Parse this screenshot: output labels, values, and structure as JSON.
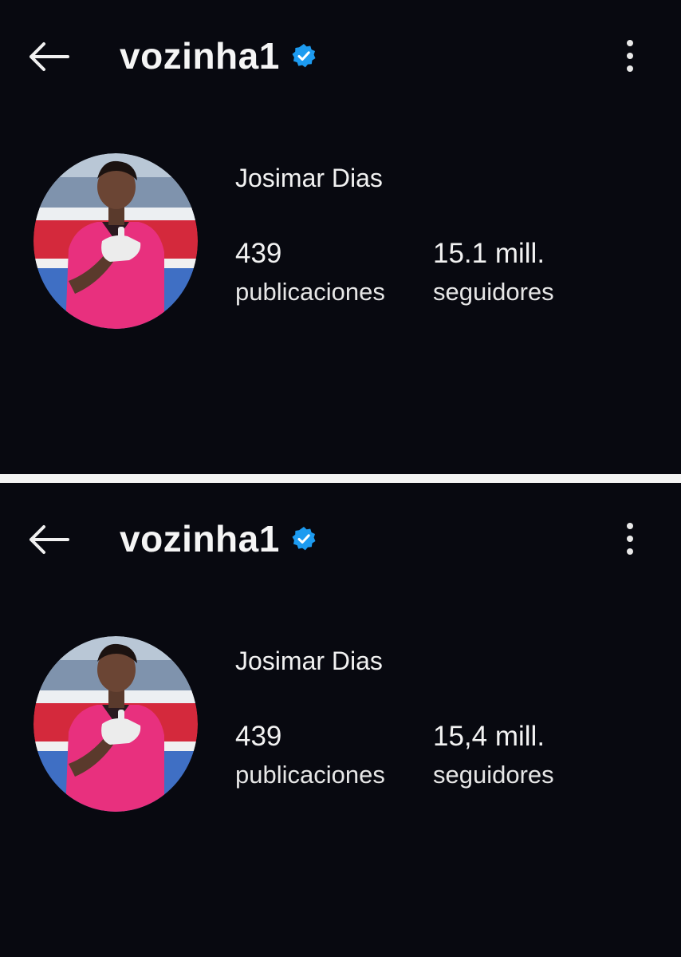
{
  "panels": [
    {
      "username": "vozinha1",
      "display_name": "Josimar Dias",
      "posts_count": "439",
      "posts_label": "publicaciones",
      "followers_count": "15.1 mill.",
      "followers_label": "seguidores"
    },
    {
      "username": "vozinha1",
      "display_name": "Josimar Dias",
      "posts_count": "439",
      "posts_label": "publicaciones",
      "followers_count": "15,4 mill.",
      "followers_label": "seguidores"
    }
  ],
  "icons": {
    "back": "arrow-left-icon",
    "verified": "verified-badge-icon",
    "more": "more-vertical-icon"
  },
  "colors": {
    "background": "#080910",
    "text": "#f2f2f2",
    "verified": "#1d9bf0",
    "jersey": "#e8307e",
    "divider": "#f4f4f4"
  }
}
